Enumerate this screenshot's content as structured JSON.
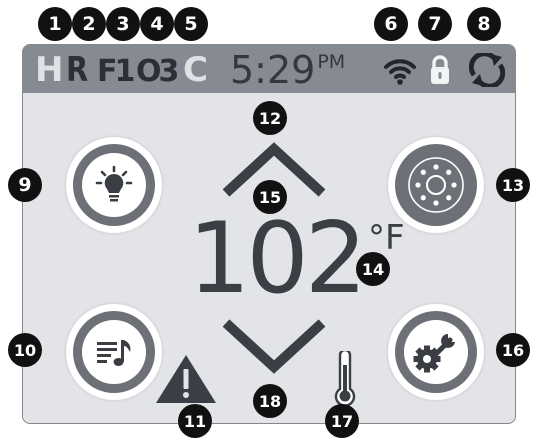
{
  "status_bar": {
    "heater_letter": "H",
    "ready_letter": "R",
    "filter_label": "F1",
    "ozone_label": "O3",
    "clean_letter": "C",
    "time": "5:29",
    "time_period": "PM",
    "icons": [
      "wifi-icon",
      "lock-icon",
      "sync-icon"
    ]
  },
  "temperature": {
    "value": "102",
    "unit": "°F"
  },
  "buttons": {
    "light": "lightbulb-icon",
    "music": "music-icon",
    "jets": "jets-icon",
    "settings": "settings-icon",
    "up": "chevron-up-icon",
    "down": "chevron-down-icon"
  },
  "indicators": [
    "warning-icon",
    "thermometer-icon"
  ],
  "callouts": [
    "1",
    "2",
    "3",
    "4",
    "5",
    "6",
    "7",
    "8",
    "9",
    "10",
    "11",
    "12",
    "13",
    "14",
    "15",
    "16",
    "17",
    "18"
  ],
  "colors": {
    "screen_bg": "#e2e4e7",
    "status_bar_bg": "#868b93",
    "status_letter_light": "#dfe1e4",
    "status_letter_dark": "#2c2f34",
    "badge": "#111111",
    "ring": "#6d7077"
  }
}
